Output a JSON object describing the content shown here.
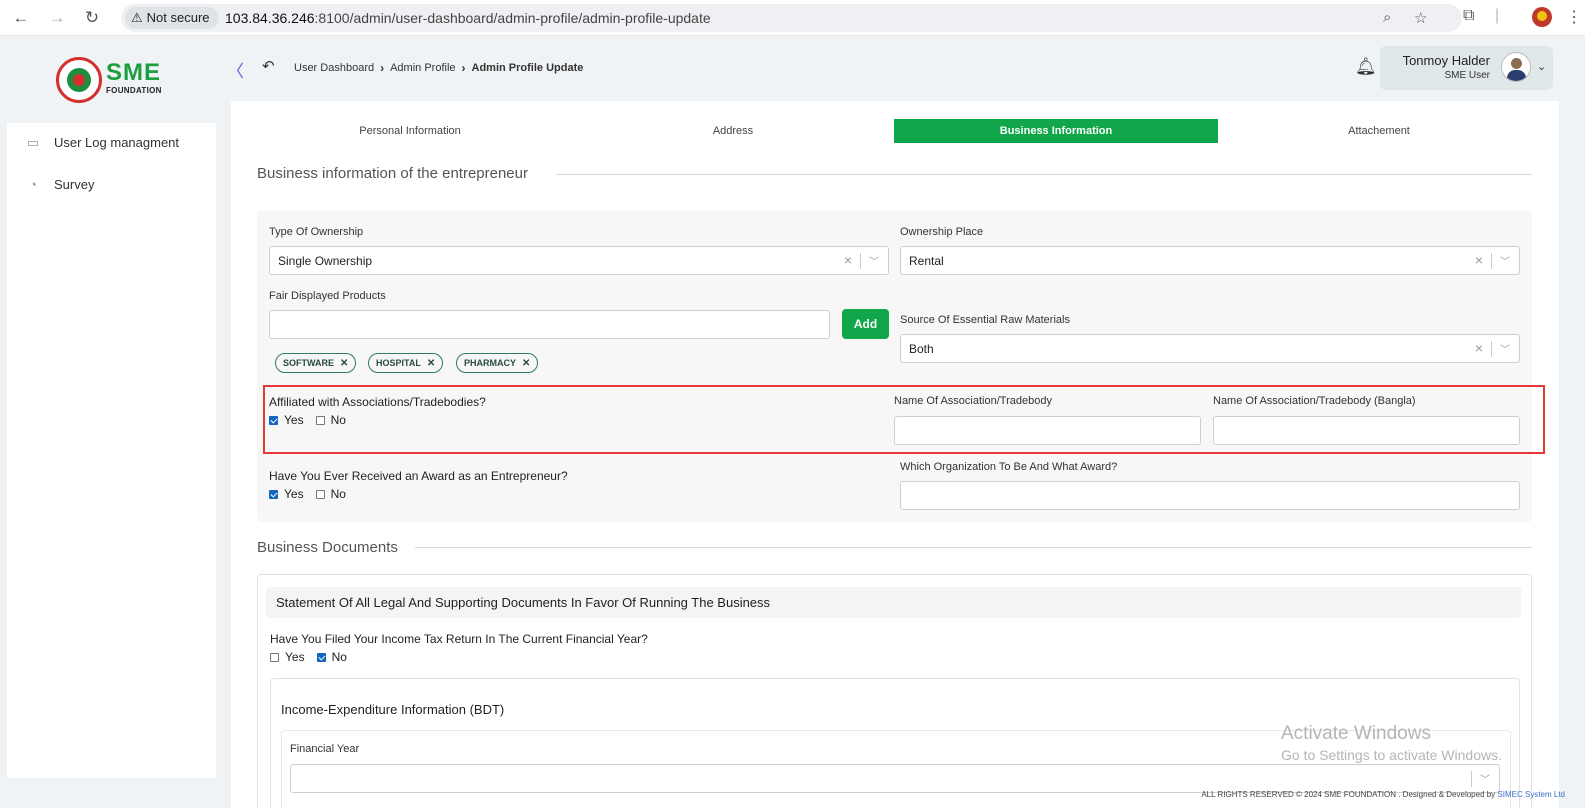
{
  "browser": {
    "security_label": "Not secure",
    "url_host": "103.84.36.246",
    "url_rest": ":8100/admin/user-dashboard/admin-profile/admin-profile-update"
  },
  "sidebar": {
    "logo_text": "SME",
    "logo_sub": "FOUNDATION",
    "items": [
      {
        "label": "User Log managment",
        "icon": "log-icon"
      },
      {
        "label": "Survey",
        "icon": "pie-chart-icon"
      }
    ]
  },
  "header": {
    "breadcrumb": [
      "User Dashboard",
      "Admin Profile",
      "Admin Profile Update"
    ],
    "user_name": "Tonmoy Halder",
    "user_role": "SME User"
  },
  "tabs": [
    {
      "label": "Personal Information",
      "active": false
    },
    {
      "label": "Address",
      "active": false
    },
    {
      "label": "Business Information",
      "active": true
    },
    {
      "label": "Attachement",
      "active": false
    }
  ],
  "business_info": {
    "heading": "Business information of the entrepreneur",
    "type_of_ownership": {
      "label": "Type Of Ownership",
      "value": "Single Ownership"
    },
    "ownership_place": {
      "label": "Ownership Place",
      "value": "Rental"
    },
    "fair_products": {
      "label": "Fair Displayed Products",
      "value": "",
      "add_label": "Add",
      "tags": [
        "SOFTWARE",
        "HOSPITAL",
        "PHARMACY"
      ]
    },
    "raw_materials": {
      "label": "Source Of Essential Raw Materials",
      "value": "Both"
    },
    "affiliated": {
      "question": "Affiliated with Associations/Tradebodies?",
      "yes": "Yes",
      "no": "No",
      "yes_checked": true,
      "no_checked": false
    },
    "association_name": {
      "label": "Name Of Association/Tradebody",
      "value": ""
    },
    "association_name_bangla": {
      "label": "Name Of Association/Tradebody (Bangla)",
      "value": ""
    },
    "award": {
      "question": "Have You Ever Received an Award as an Entrepreneur?",
      "yes": "Yes",
      "no": "No",
      "yes_checked": true,
      "no_checked": false
    },
    "award_org": {
      "label": "Which Organization To Be And What Award?",
      "value": ""
    }
  },
  "business_documents": {
    "heading": "Business Documents",
    "statement_title": "Statement Of All Legal And Supporting Documents In Favor Of Running The Business",
    "tax_question": "Have You Filed Your Income Tax Return In The Current Financial Year?",
    "tax_yes": "Yes",
    "tax_no": "No",
    "tax_yes_checked": false,
    "tax_no_checked": true,
    "income_title": "Income-Expenditure Information (BDT)",
    "financial_year_label": "Financial Year",
    "financial_year_value": ""
  },
  "watermark": {
    "line1": "Activate Windows",
    "line2": "Go to Settings to activate Windows."
  },
  "footer": {
    "text": "ALL RIGHTS RESERVED © 2024 SME FOUNDATION . Designed & Developed by",
    "link": "SIMEC System Ltd"
  },
  "colors": {
    "brand_green": "#11a649",
    "highlight_red": "#e53935",
    "checkbox_blue": "#1565c0"
  }
}
